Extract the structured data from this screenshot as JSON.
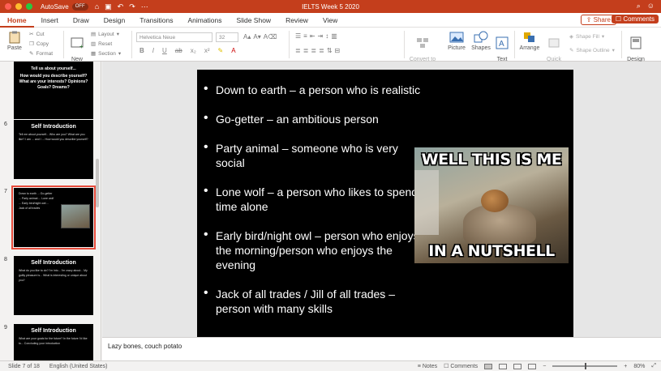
{
  "titlebar": {
    "autosave_label": "AutoSave",
    "autosave_state": "OFF",
    "doc_title": "IELTS Week 5 2020"
  },
  "tabs": [
    "Home",
    "Insert",
    "Draw",
    "Design",
    "Transitions",
    "Animations",
    "Slide Show",
    "Review",
    "View"
  ],
  "share_label": "Share",
  "comments_label": "Comments",
  "ribbon": {
    "paste": "Paste",
    "cut": "Cut",
    "copy": "Copy",
    "format": "Format",
    "new_slide": "New\nSlide",
    "layout": "Layout",
    "reset": "Reset",
    "section": "Section",
    "font_name": "Helvetica Neue",
    "font_size": "32",
    "convert": "Convert to\nSmartArt",
    "picture": "Picture",
    "shapes": "Shapes",
    "text_box": "Text\nBox",
    "arrange": "Arrange",
    "quick_styles": "Quick\nStyles",
    "shape_fill": "Shape Fill",
    "shape_outline": "Shape Outline",
    "design_ideas": "Design\nIdeas"
  },
  "thumbnails": [
    {
      "num": "",
      "title": "Tell us about yourself...",
      "lines": "How would you describe yourself? What are your interests? Opinions? Goals? Dreams?"
    },
    {
      "num": "6",
      "title": "Self Introduction",
      "lines": "Tell me about yourself... Who are you? What are you like? I am ... and I ... How would you describe yourself?"
    },
    {
      "num": "7",
      "title": "",
      "lines": "Down to earth ... Go-getter ... Party animal ... Lone wolf ... Early bird/night owl ... Jack of all trades"
    },
    {
      "num": "8",
      "title": "Self Introduction",
      "lines": "What do you like to do? I'm into... I'm crazy about... My guilty pleasure is... What is interesting or unique about you?"
    },
    {
      "num": "9",
      "title": "Self Introduction",
      "lines": "What are your goals for the future? In the future I'd like to... Concluding your introduction"
    }
  ],
  "slide": {
    "bullets": [
      "Down to earth – a person who is realistic",
      "Go-getter – an ambitious person",
      "Party animal – someone who is very social",
      "Lone wolf – a person who likes to spend time alone",
      "Early bird/night owl – person who enjoys the morning/person who enjoys the evening",
      "Jack of all trades / Jill of all trades – person with many skills"
    ],
    "meme_top": "WELL THIS IS ME",
    "meme_bottom": "IN A NUTSHELL"
  },
  "notes_text": "Lazy bones, couch potato",
  "status": {
    "slide_info": "Slide 7 of 18",
    "language": "English (United States)",
    "notes": "Notes",
    "comments": "Comments",
    "zoom": "80%"
  }
}
